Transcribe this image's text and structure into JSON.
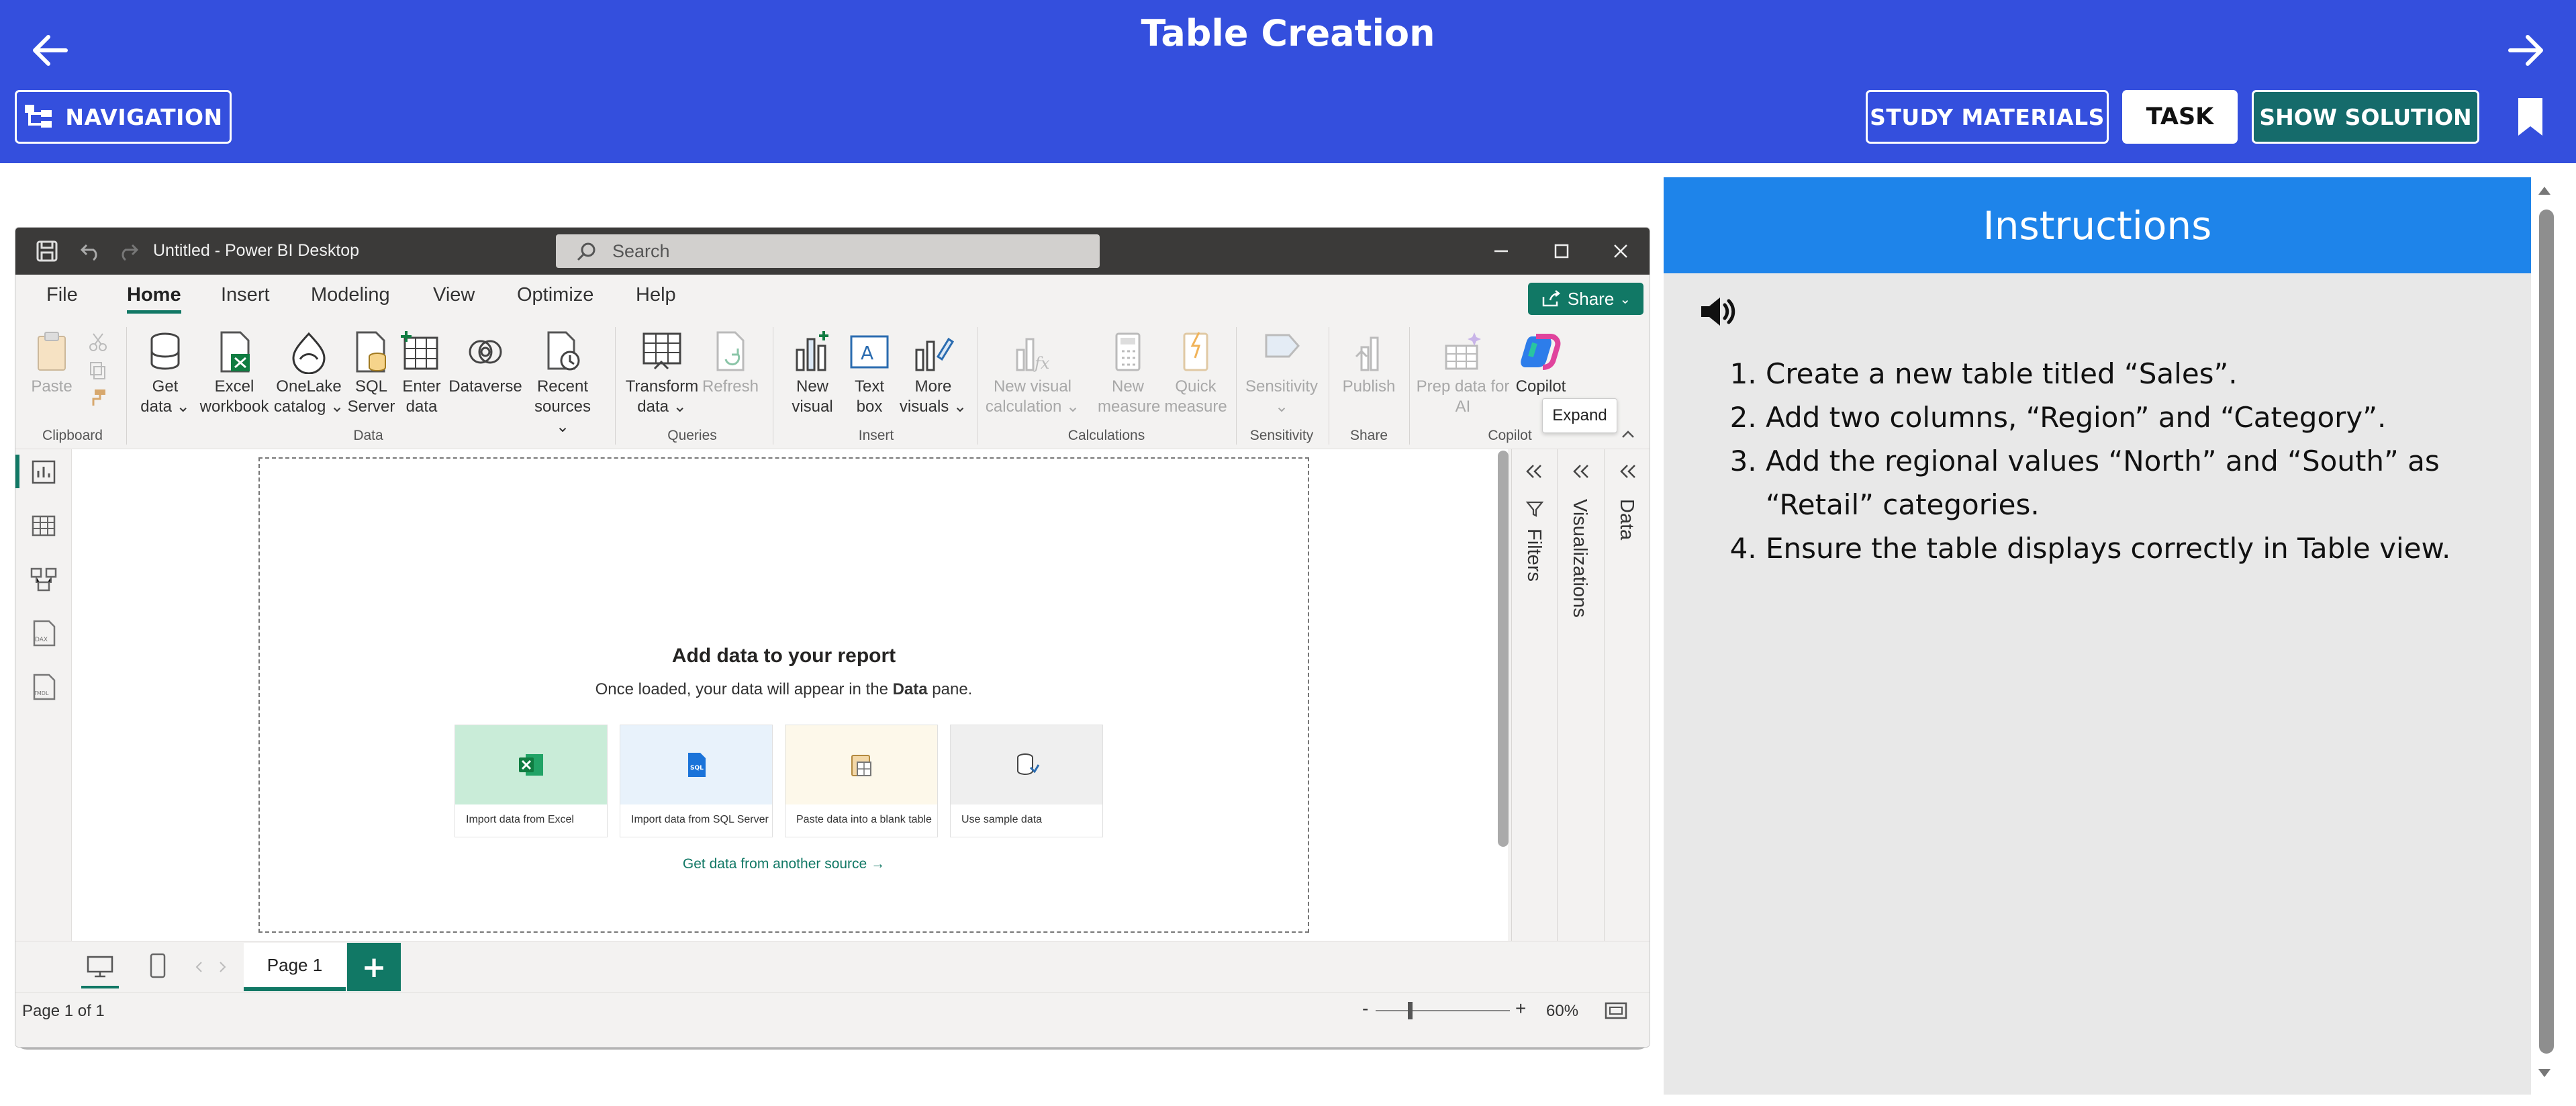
{
  "header": {
    "title": "Table Creation",
    "navigation_label": "NAVIGATION",
    "study_materials_label": "STUDY MATERIALS",
    "task_label": "TASK",
    "show_solution_label": "SHOW SOLUTION",
    "background_color": "#344fdd"
  },
  "instructions": {
    "heading": "Instructions",
    "steps": [
      "Create a new table titled “Sales”.",
      "Add two columns, “Region” and “Category”.",
      "Add the regional values “North” and “South” as “Retail” categories.",
      "Ensure the table displays correctly in Table view."
    ]
  },
  "pbi": {
    "window_title": "Untitled - Power BI Desktop",
    "search_placeholder": "Search",
    "menu": [
      "File",
      "Home",
      "Insert",
      "Modeling",
      "View",
      "Optimize",
      "Help"
    ],
    "active_menu": "Home",
    "share_label": "Share",
    "ribbon": {
      "paste": "Paste",
      "get_data": [
        "Get",
        "data ⌄"
      ],
      "excel_workbook": [
        "Excel",
        "workbook"
      ],
      "onelake_catalog": [
        "OneLake",
        "catalog ⌄"
      ],
      "sql_server": [
        "SQL",
        "Server"
      ],
      "enter_data": [
        "Enter",
        "data"
      ],
      "dataverse": "Dataverse",
      "recent_sources": [
        "Recent",
        "sources ⌄"
      ],
      "transform_data": [
        "Transform",
        "data ⌄"
      ],
      "refresh": "Refresh",
      "new_visual": [
        "New",
        "visual"
      ],
      "text_box": [
        "Text",
        "box"
      ],
      "more_visuals": [
        "More",
        "visuals ⌄"
      ],
      "new_visual_calculation": [
        "New visual",
        "calculation ⌄"
      ],
      "new_measure": [
        "New",
        "measure"
      ],
      "quick_measure": [
        "Quick",
        "measure"
      ],
      "sensitivity": [
        "Sensitivity",
        "⌄"
      ],
      "publish": "Publish",
      "prep_data_for_ai": [
        "Prep data for",
        "AI"
      ],
      "copilot": "Copilot",
      "groups": {
        "clipboard": "Clipboard",
        "data": "Data",
        "queries": "Queries",
        "insert": "Insert",
        "calculations": "Calculations",
        "sensitivity": "Sensitivity",
        "share": "Share",
        "copilot": "Copilot"
      }
    },
    "expand_tooltip": "Expand",
    "panes": {
      "filters": "Filters",
      "visualizations": "Visualizations",
      "data": "Data"
    },
    "empty_state": {
      "heading": "Add data to your report",
      "sub_before": "Once loaded, your data will appear in the ",
      "sub_bold": "Data",
      "sub_after": " pane.",
      "cards": [
        {
          "label": "Import data from Excel",
          "bg": "#c9ecd8",
          "icon": "excel-icon"
        },
        {
          "label": "Import data from SQL Server",
          "bg": "#e8f2fb",
          "icon": "sql-server-icon"
        },
        {
          "label": "Paste data into a blank table",
          "bg": "#fdf8ea",
          "icon": "paste-table-icon"
        },
        {
          "label": "Use sample data",
          "bg": "#efefef",
          "icon": "sample-data-icon"
        }
      ],
      "link": "Get data from another source →"
    },
    "page_tab": "Page 1",
    "add_page": "+",
    "status": {
      "page_count": "Page 1 of 1",
      "zoom_minus": "-",
      "zoom_plus": "+",
      "zoom": "60%"
    },
    "accent_color": "#117865"
  }
}
